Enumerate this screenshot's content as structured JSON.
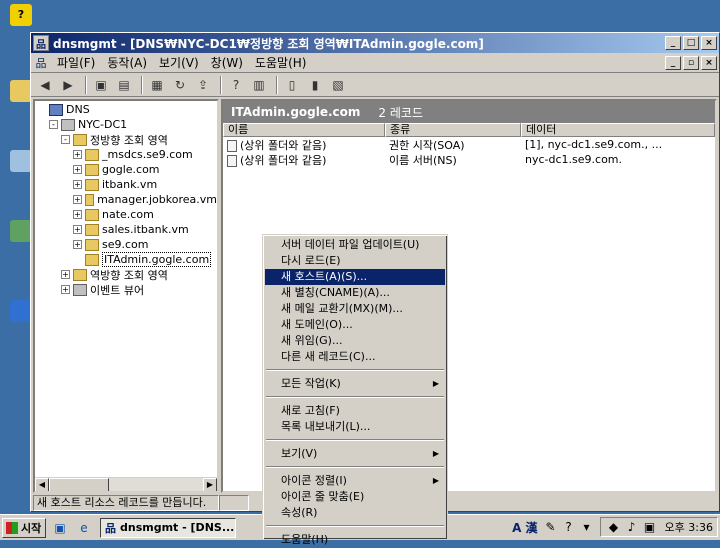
{
  "window": {
    "title": "dnsmgmt - [DNS₩NYC-DC1₩정방향 조회 영역₩ITAdmin.gogle.com]"
  },
  "menubar": {
    "items": [
      "파일(F)",
      "동작(A)",
      "보기(V)",
      "창(W)",
      "도움말(H)"
    ]
  },
  "tree": {
    "items": [
      {
        "label": "DNS",
        "icon": "dns-icon",
        "indent": 0,
        "expander": ""
      },
      {
        "label": "NYC-DC1",
        "icon": "server-icon",
        "indent": 1,
        "expander": "−"
      },
      {
        "label": "정방향 조회 영역",
        "icon": "folder-icon",
        "indent": 2,
        "expander": "−"
      },
      {
        "label": "_msdcs.se9.com",
        "icon": "zone-icon",
        "indent": 3,
        "expander": "+"
      },
      {
        "label": "gogle.com",
        "icon": "zone-icon",
        "indent": 3,
        "expander": "+"
      },
      {
        "label": "itbank.vm",
        "icon": "zone-icon",
        "indent": 3,
        "expander": "+"
      },
      {
        "label": "manager.jobkorea.vm",
        "icon": "zone-icon",
        "indent": 3,
        "expander": "+"
      },
      {
        "label": "nate.com",
        "icon": "zone-icon",
        "indent": 3,
        "expander": "+"
      },
      {
        "label": "sales.itbank.vm",
        "icon": "zone-icon",
        "indent": 3,
        "expander": "+"
      },
      {
        "label": "se9.com",
        "icon": "zone-icon",
        "indent": 3,
        "expander": "+"
      },
      {
        "label": "ITAdmin.gogle.com",
        "icon": "zone-icon",
        "indent": 3,
        "expander": "",
        "selected": true
      },
      {
        "label": "역방향 조회 영역",
        "icon": "folder-icon",
        "indent": 2,
        "expander": "+"
      },
      {
        "label": "이벤트 뷰어",
        "icon": "event-viewer-icon",
        "indent": 2,
        "expander": "+"
      }
    ]
  },
  "list": {
    "zone_title": "ITAdmin.gogle.com",
    "record_count": "2 레코드",
    "columns": [
      "이름",
      "종류",
      "데이터"
    ],
    "rows": [
      [
        "(상위 폴더와 같음)",
        "권한 시작(SOA)",
        "[1], nyc-dc1.se9.com., ..."
      ],
      [
        "(상위 폴더와 같음)",
        "이름 서버(NS)",
        "nyc-dc1.se9.com."
      ]
    ]
  },
  "status": {
    "text": "새 호스트 리소스 레코드를 만듭니다."
  },
  "context_menu": {
    "groups": [
      [
        {
          "label": "서버 데이터 파일 업데이트(U)"
        },
        {
          "label": "다시 로드(E)"
        },
        {
          "label": "새 호스트(A)(S)...",
          "highlighted": true
        },
        {
          "label": "새 별칭(CNAME)(A)..."
        },
        {
          "label": "새 메일 교환기(MX)(M)..."
        },
        {
          "label": "새 도메인(O)..."
        },
        {
          "label": "새 위임(G)..."
        },
        {
          "label": "다른 새 레코드(C)..."
        }
      ],
      [
        {
          "label": "모든 작업(K)",
          "submenu": true
        }
      ],
      [
        {
          "label": "새로 고침(F)"
        },
        {
          "label": "목록 내보내기(L)..."
        }
      ],
      [
        {
          "label": "보기(V)",
          "submenu": true
        }
      ],
      [
        {
          "label": "아이콘 정렬(I)",
          "submenu": true
        },
        {
          "label": "아이콘 줄 맞춤(E)"
        },
        {
          "label": "속성(R)"
        }
      ],
      [
        {
          "label": "도움말(H)"
        }
      ]
    ]
  },
  "taskbar": {
    "start_label": "시작",
    "task_label": "dnsmgmt - [DNS...",
    "ime_label": "A 漢",
    "clock": "오후 3:36"
  }
}
